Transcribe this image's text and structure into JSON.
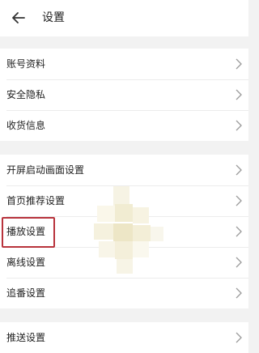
{
  "header": {
    "title": "设置"
  },
  "groups": [
    {
      "items": [
        "账号资料",
        "安全隐私",
        "收货信息"
      ]
    },
    {
      "items": [
        "开屏启动画面设置",
        "首页推荐设置",
        "播放设置",
        "离线设置",
        "追番设置"
      ]
    },
    {
      "items": [
        "推送设置"
      ]
    }
  ],
  "highlighted_item": "播放设置"
}
